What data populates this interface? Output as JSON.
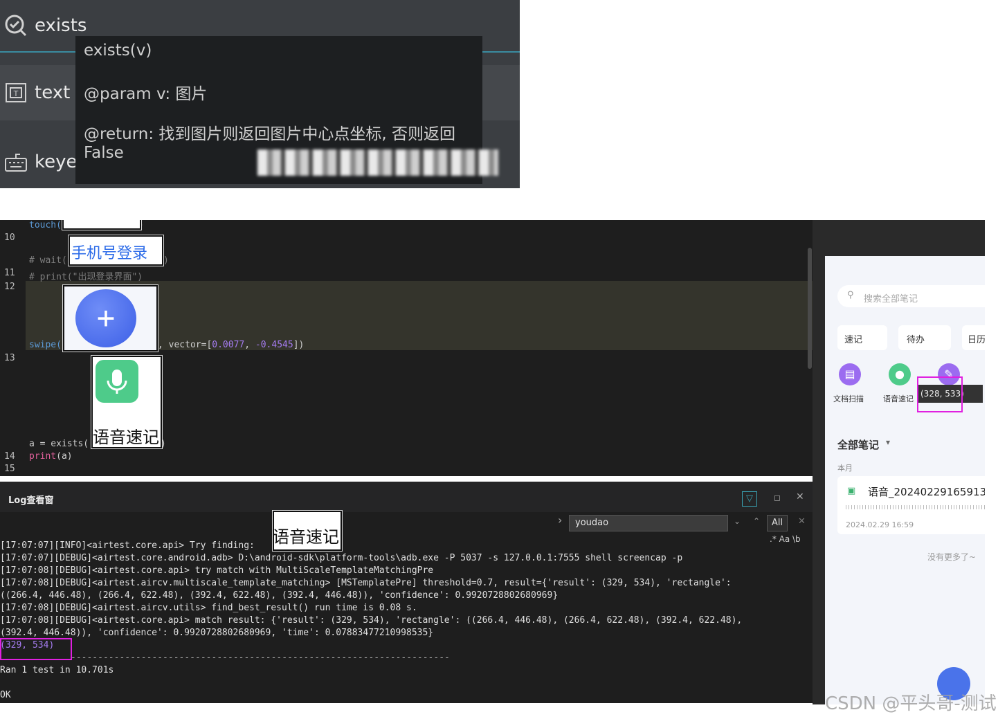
{
  "api_panel": {
    "rows": [
      {
        "icon": "magnifier-check-icon",
        "label": "exists"
      },
      {
        "icon": "text-box-icon",
        "label": "text"
      },
      {
        "icon": "keyboard-icon",
        "label": "keye"
      }
    ],
    "tooltip": {
      "signature": "exists(v)",
      "param": "@param v: 图片",
      "return_line1": "@return: 找到图片则返回图片中心点坐标, 否则返回",
      "return_line2": "False"
    }
  },
  "editor": {
    "lines": [
      {
        "n": "",
        "code": "touch("
      },
      {
        "n": "10",
        "code": ""
      },
      {
        "n": "",
        "code": "# wait("
      },
      {
        "n": "11",
        "code": "# print(\"出现登录界面\")"
      },
      {
        "n": "12",
        "code": ""
      },
      {
        "n": "",
        "code": "swipe("
      },
      {
        "n": "13",
        "code": ""
      },
      {
        "n": "",
        "code": "a = exists("
      },
      {
        "n": "14",
        "code": "print(a)"
      },
      {
        "n": "15",
        "code": ""
      }
    ],
    "touch_close": ")",
    "wait_close": ")",
    "swipe_args": ", vector=[",
    "vec_x": "0.0077",
    "vec_sep": ", ",
    "vec_y": "-0.4545",
    "swipe_close": "])",
    "exists_close": ")",
    "print_fn": "print",
    "print_arg": "(a)",
    "thumb_login": "手机号登录",
    "thumb_plus": "+",
    "thumb_voice": "语音速记"
  },
  "log": {
    "title": "Log查看窗",
    "find_value": "youdao",
    "find_all": "All",
    "find_opts": ".* Aa \\b",
    "thumb_voice": "语音速记",
    "lines": [
      "[17:07:07][INFO]<airtest.core.api> Try finding:",
      "[17:07:07][DEBUG]<airtest.core.android.adb> D:\\android-sdk\\platform-tools\\adb.exe -P 5037 -s 127.0.0.1:7555 shell screencap -p",
      "[17:07:08][DEBUG]<airtest.core.api> try match with MultiScaleTemplateMatchingPre",
      "[17:07:08][DEBUG]<airtest.aircv.multiscale_template_matching> [MSTemplatePre] threshold=0.7, result={'result': (329, 534), 'rectangle':",
      "((266.4, 446.48), (266.4, 622.48), (392.4, 622.48), (392.4, 446.48)), 'confidence': 0.9920728802680969}",
      "[17:07:08][DEBUG]<airtest.aircv.utils> find_best_result() run time is 0.08 s.",
      "[17:07:08][DEBUG]<airtest.core.api> match result: {'result': (329, 534), 'rectangle': ((266.4, 446.48), (266.4, 622.48), (392.4, 622.48),",
      "(392.4, 446.48)), 'confidence': 0.9920728802680969, 'time': 0.07883477210998535}",
      "(329, 534)",
      "----------------------------------------------------------------------",
      "Ran 1 test in 10.701s",
      "",
      "OK"
    ]
  },
  "phone": {
    "search_placeholder": "搜索全部笔记",
    "tabs": [
      "速记",
      "待办",
      "日历"
    ],
    "quick": [
      "文档扫描",
      "语音速记"
    ],
    "coord_popup": "(328, 533)",
    "section_title": "全部笔记",
    "month": "本月",
    "note_title": "语音_20240229165913.",
    "note_date": "2024.02.29 16:59",
    "no_more": "没有更多了~"
  },
  "watermark": "CSDN @平头哥-测试"
}
